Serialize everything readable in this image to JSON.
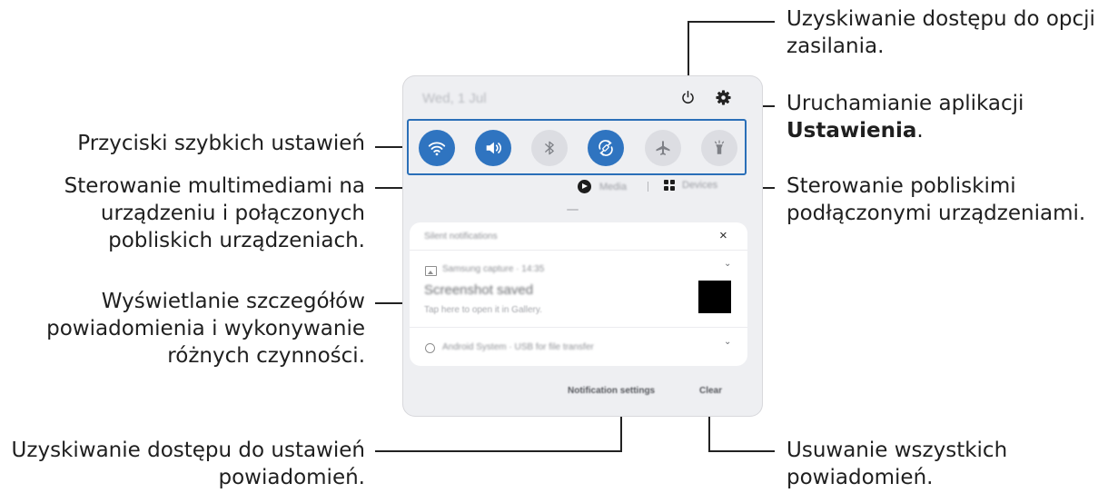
{
  "callouts": {
    "power_line1": "Uzyskiwanie dostępu do opcji",
    "power_line2": "zasilania.",
    "settings_line1": "Uruchamianie aplikacji",
    "settings_bold": "Ustawienia",
    "settings_end": ".",
    "quick": "Przyciski szybkich ustawień",
    "media_line1": "Sterowanie multimediami na",
    "media_line2": "urządzeniu i połączonych",
    "media_line3": "pobliskich urządzeniach.",
    "nearby_line1": "Sterowanie pobliskimi",
    "nearby_line2": "podłączonymi urządzeniami.",
    "details_line1": "Wyświetlanie szczegółów",
    "details_line2": "powiadomienia i wykonywanie",
    "details_line3": "różnych czynności.",
    "notif_settings_line1": "Uzyskiwanie dostępu do ustawień",
    "notif_settings_line2": "powiadomień.",
    "clear_line1": "Usuwanie wszystkich",
    "clear_line2": "powiadomień."
  },
  "panel": {
    "date": "Wed, 1 Jul",
    "icons": [
      "power-icon",
      "gear-icon"
    ],
    "quick_settings": [
      {
        "name": "wifi-icon",
        "state": "on"
      },
      {
        "name": "sound-icon",
        "state": "on"
      },
      {
        "name": "bluetooth-icon",
        "state": "off"
      },
      {
        "name": "auto-rotate-icon",
        "state": "on"
      },
      {
        "name": "airplane-icon",
        "state": "off"
      },
      {
        "name": "flashlight-icon",
        "state": "off"
      }
    ],
    "media_label": "Media",
    "devices_label": "Devices",
    "notifications": {
      "header": "Silent notifications",
      "close": "×",
      "app_line": "Samsung capture · 14:35",
      "title": "Screenshot saved",
      "subtitle": "Tap here to open it in Gallery.",
      "system_line": "Android System · USB for file transfer",
      "chevron": "⌄"
    },
    "notification_settings_label": "Notification settings",
    "clear_label": "Clear"
  },
  "colors": {
    "accent": "#2f74c0",
    "toggle_off": "#dcdde2",
    "panel_bg": "#eeeff2",
    "highlight_border": "#2a6fb8"
  }
}
